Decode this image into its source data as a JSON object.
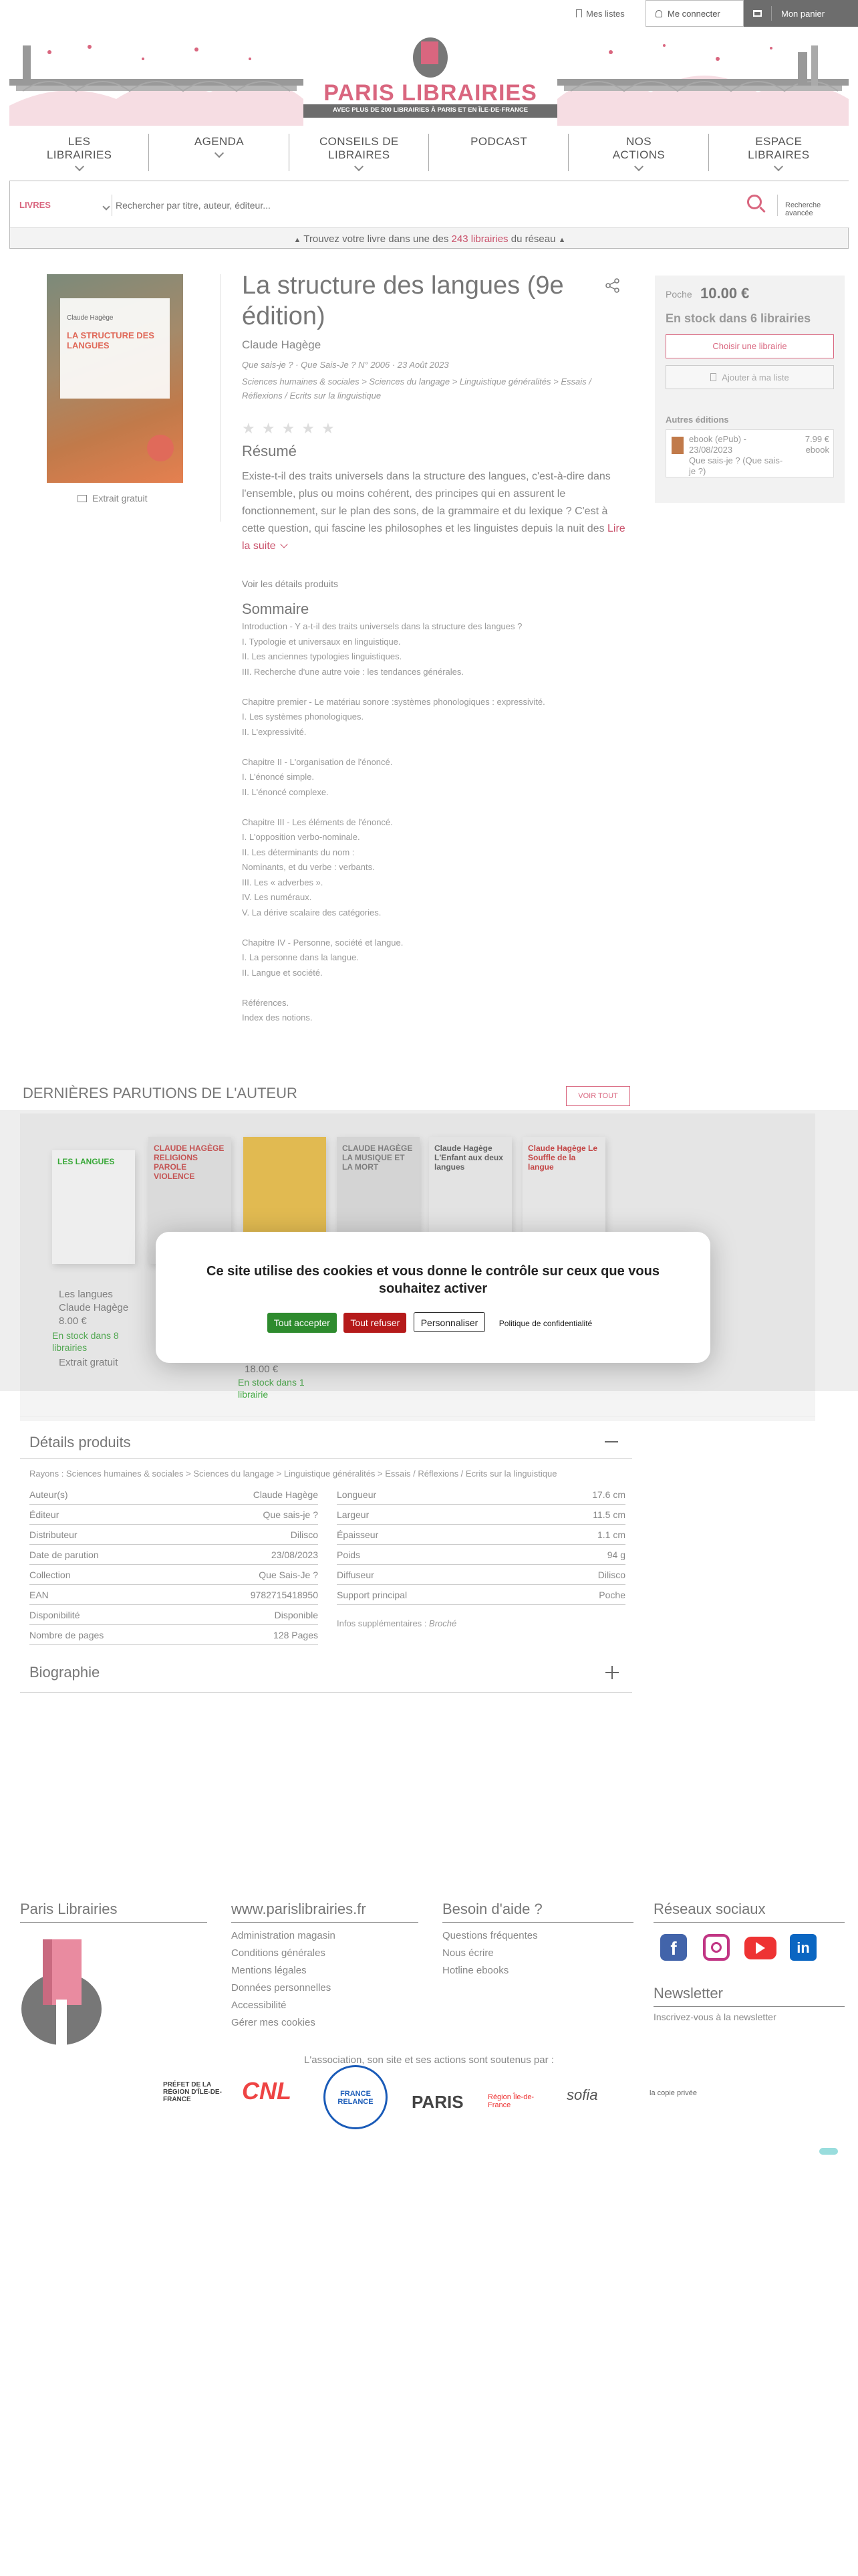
{
  "topbar": {
    "mylists": "Mes listes",
    "login": "Me connecter",
    "cart": "Mon panier"
  },
  "brand": {
    "name": "PARIS LIBRAIRIES",
    "tagline": "AVEC PLUS DE 200 LIBRAIRIES À PARIS ET EN ÎLE-DE-FRANCE",
    "accent": "#d9667f"
  },
  "nav": [
    {
      "label": "LES\nLIBRAIRIES"
    },
    {
      "label": "AGENDA"
    },
    {
      "label": "CONSEILS DE\nLIBRAIRES"
    },
    {
      "label": "PODCAST"
    },
    {
      "label": "NOS\nACTIONS"
    },
    {
      "label": "ESPACE\nLIBRAIRES"
    }
  ],
  "search": {
    "category": "LIVRES",
    "placeholder": "Rechercher par titre, auteur, éditeur...",
    "advanced": "Recherche avancée",
    "hint_pre": "Trouvez votre livre dans une des",
    "hint_count": "243 librairies",
    "hint_post": "du réseau"
  },
  "book": {
    "title": "La structure des langues (9e édition)",
    "author": "Claude Hagège",
    "meta": "Que sais-je ? · Que Sais-Je ? N° 2006 · 23 Août 2023",
    "categories": "Sciences humaines & sociales > Sciences du langage > Linguistique généralités > Essais / Réflexions / Ecrits sur la linguistique",
    "cover_author": "Claude Hagège",
    "cover_title": "LA STRUCTURE DES LANGUES",
    "excerpt": "Extrait gratuit",
    "rating": 0
  },
  "summary": {
    "heading": "Résumé",
    "text": "Existe-t-il des traits universels dans la structure des langues, c'est-à-dire dans l'ensemble, plus ou moins cohérent, des principes qui en assurent le fonctionnement, sur le plan des sons, de la grammaire et du lexique ? C'est à cette question, qui fascine les philosophes et les linguistes depuis la nuit des",
    "more": "Lire la suite",
    "details_link": "Voir les détails produits"
  },
  "toc": {
    "heading": "Sommaire",
    "lines": [
      "Introduction - Y a-t-il des traits universels dans la structure des langues ?",
      "I. Typologie et universaux en linguistique.",
      "II. Les anciennes typologies linguistiques.",
      "III. Recherche d'une autre voie : les tendances générales.",
      "",
      "Chapitre premier - Le matériau sonore :systèmes phonologiques : expressivité.",
      "I. Les systèmes phonologiques.",
      "II. L'expressivité.",
      "",
      "Chapitre II - L'organisation de l'énoncé.",
      "I. L'énoncé simple.",
      "II. L'énoncé complexe.",
      "",
      "Chapitre III - Les éléments de l'énoncé.",
      "I. L'opposition verbo-nominale.",
      "II. Les déterminants du nom :",
      "Nominants, et du verbe : verbants.",
      "III. Les « adverbes ».",
      "IV. Les numéraux.",
      "V. La dérive scalaire des catégories.",
      "",
      "Chapitre IV - Personne, société et langue.",
      "I. La personne dans la langue.",
      "II. Langue et société.",
      "",
      "Références.",
      "Index des notions."
    ]
  },
  "purchase": {
    "format": "Poche",
    "price": "10.00 €",
    "stock": "En stock dans 6 librairies",
    "choose": "Choisir une librairie",
    "add_list": "Ajouter à ma liste",
    "other_editions": "Autres éditions",
    "edition": {
      "name": "ebook (ePub) - 23/08/2023",
      "price": "7.99 €",
      "type": "ebook",
      "series": "Que sais-je ? (Que sais-je ?)"
    }
  },
  "latest": {
    "heading": "DERNIÈRES PARUTIONS DE L'AUTEUR",
    "see_all": "VOIR TOUT",
    "books": [
      {
        "title": "Les langues",
        "author": "Claude Hagège",
        "price": "8.00 €",
        "stock": "En stock dans 8 librairies",
        "excerpt": "Extrait gratuit",
        "cover_text": "LES LANGUES"
      },
      {
        "title": "",
        "author": "",
        "price": "",
        "stock": "",
        "cover_text": "CLAUDE HAGÈGE RELIGIONS PAROLE VIOLENCE"
      },
      {
        "title": "",
        "author": "",
        "price": "18.00 €",
        "stock": "En stock dans 1 librairie",
        "cover_text": ""
      },
      {
        "title": "",
        "author": "",
        "price": "",
        "stock": "",
        "cover_text": "CLAUDE HAGÈGE LA MUSIQUE ET LA MORT"
      },
      {
        "title": "",
        "author": "",
        "price": "",
        "stock": "",
        "cover_text": "Claude Hagège L'Enfant aux deux langues"
      },
      {
        "title": "",
        "author": "",
        "price": "",
        "stock": "",
        "cover_text": "Claude Hagège Le Souffle de la langue"
      }
    ]
  },
  "cookie": {
    "text": "Ce site utilise des cookies et vous donne le contrôle sur ceux que vous souhaitez activer",
    "accept": "Tout accepter",
    "refuse": "Tout refuser",
    "customize": "Personnaliser",
    "policy": "Politique de confidentialité"
  },
  "details": {
    "heading": "Détails produits",
    "rayons": "Rayons : Sciences humaines & sociales > Sciences du langage > Linguistique généralités > Essais / Réflexions / Ecrits sur la linguistique",
    "left": [
      {
        "k": "Auteur(s)",
        "v": "Claude Hagège"
      },
      {
        "k": "Éditeur",
        "v": "Que sais-je ?"
      },
      {
        "k": "Distributeur",
        "v": "Dilisco"
      },
      {
        "k": "Date de parution",
        "v": "23/08/2023"
      },
      {
        "k": "Collection",
        "v": "Que Sais-Je ?"
      },
      {
        "k": "EAN",
        "v": "9782715418950"
      },
      {
        "k": "Disponibilité",
        "v": "Disponible"
      },
      {
        "k": "Nombre de pages",
        "v": "128 Pages"
      }
    ],
    "right": [
      {
        "k": "Longueur",
        "v": "17.6 cm"
      },
      {
        "k": "Largeur",
        "v": "11.5 cm"
      },
      {
        "k": "Épaisseur",
        "v": "1.1 cm"
      },
      {
        "k": "Poids",
        "v": "94 g"
      },
      {
        "k": "Diffuseur",
        "v": "Dilisco"
      },
      {
        "k": "Support principal",
        "v": "Poche"
      }
    ],
    "extra_label": "Infos supplémentaires :",
    "extra_value": "Broché"
  },
  "bio": {
    "heading": "Biographie"
  },
  "footer": {
    "col1": {
      "heading": "Paris Librairies"
    },
    "col2": {
      "heading": "www.parislibrairies.fr",
      "links": [
        "Administration magasin",
        "Conditions générales",
        "Mentions légales",
        "Données personnelles",
        "Accessibilité",
        "Gérer mes cookies"
      ]
    },
    "col3": {
      "heading": "Besoin d'aide ?",
      "links": [
        "Questions fréquentes",
        "Nous écrire",
        "Hotline ebooks"
      ]
    },
    "col4": {
      "heading": "Réseaux sociaux",
      "newsletter": "Newsletter",
      "newsletter_text": "Inscrivez-vous à la newsletter"
    },
    "support": "L'association, son site et ses actions sont soutenus par :",
    "partners": [
      "PRÉFET DE LA RÉGION D'ÎLE-DE-FRANCE",
      "CNL",
      "FRANCE RELANCE",
      "PARIS",
      "Région Île-de-France",
      "sofia",
      "la copie privée"
    ]
  }
}
